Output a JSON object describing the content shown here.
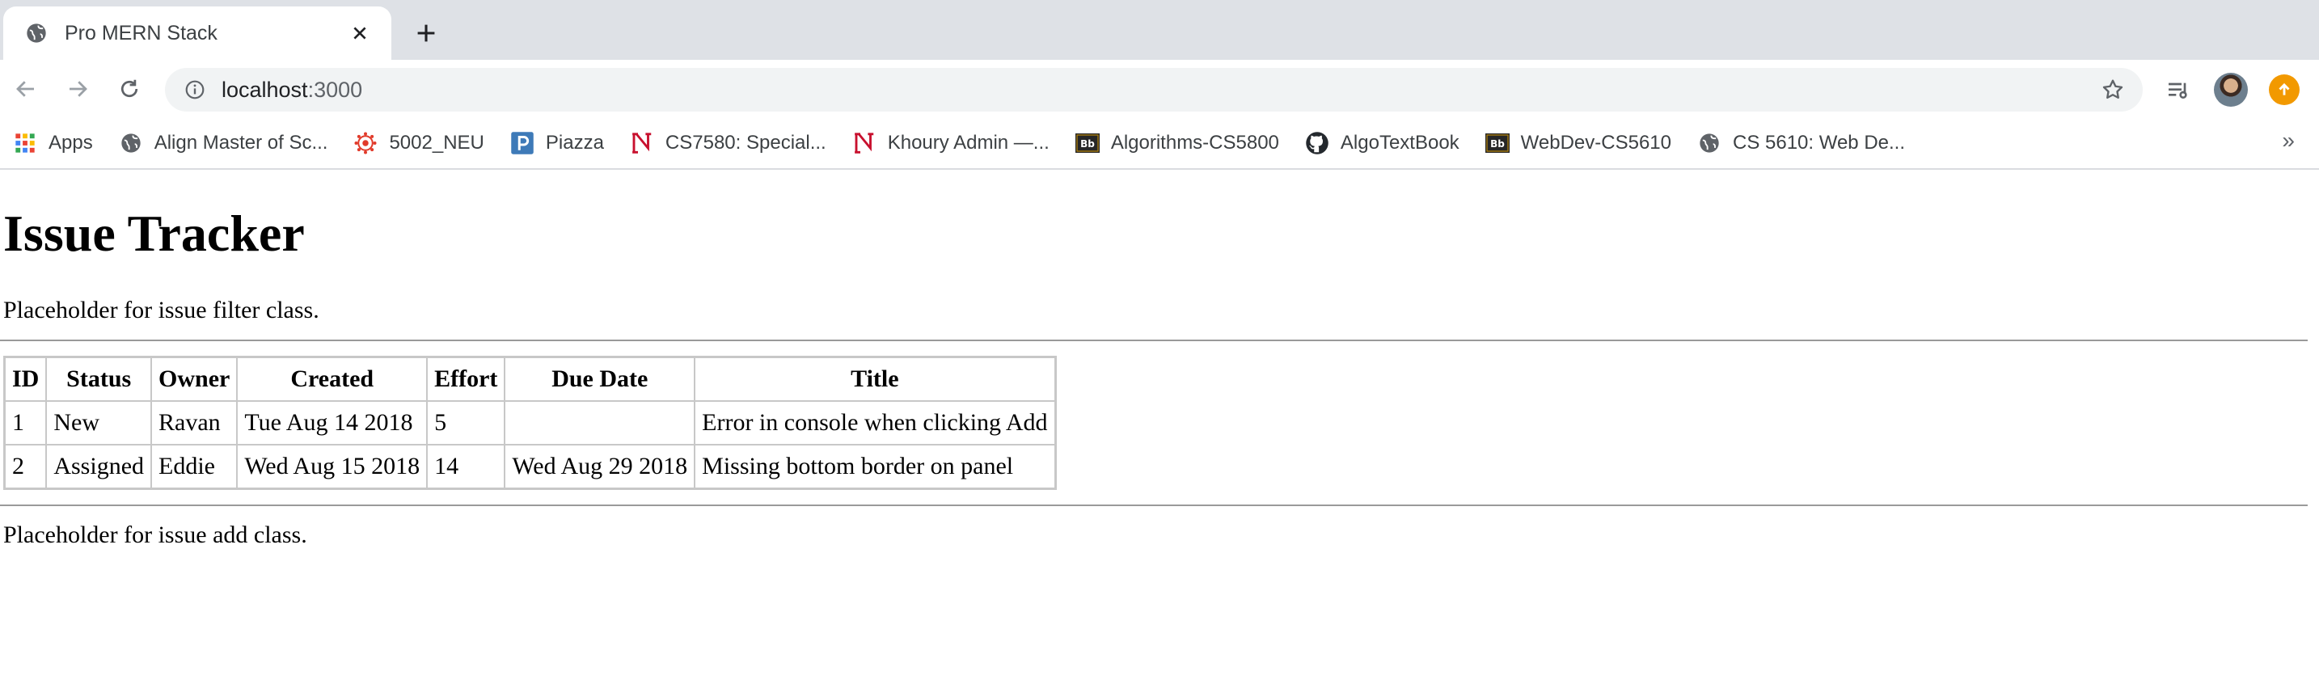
{
  "browser": {
    "tab": {
      "title": "Pro MERN Stack"
    },
    "address": {
      "host": "localhost",
      "port": ":3000"
    },
    "bookmarks": [
      {
        "label": "Apps",
        "icon": "apps-grid-icon"
      },
      {
        "label": "Align Master of Sc...",
        "icon": "globe-icon"
      },
      {
        "label": "5002_NEU",
        "icon": "canvas-icon"
      },
      {
        "label": "Piazza",
        "icon": "piazza-icon"
      },
      {
        "label": "CS7580: Special...",
        "icon": "northeastern-icon"
      },
      {
        "label": "Khoury Admin —...",
        "icon": "northeastern-icon"
      },
      {
        "label": "Algorithms-CS5800",
        "icon": "blackboard-icon"
      },
      {
        "label": "AlgoTextBook",
        "icon": "github-icon"
      },
      {
        "label": "WebDev-CS5610",
        "icon": "blackboard-icon"
      },
      {
        "label": "CS 5610: Web De...",
        "icon": "globe-icon"
      }
    ],
    "bookmarks_more": "»"
  },
  "page": {
    "heading": "Issue Tracker",
    "filter_placeholder": "Placeholder for issue filter class.",
    "add_placeholder": "Placeholder for issue add class.",
    "table": {
      "headers": [
        "ID",
        "Status",
        "Owner",
        "Created",
        "Effort",
        "Due Date",
        "Title"
      ],
      "rows": [
        [
          "1",
          "New",
          "Ravan",
          "Tue Aug 14 2018",
          "5",
          "",
          "Error in console when clicking Add"
        ],
        [
          "2",
          "Assigned",
          "Eddie",
          "Wed Aug 15 2018",
          "14",
          "Wed Aug 29 2018",
          "Missing bottom border on panel"
        ]
      ]
    }
  },
  "colors": {
    "tabstrip_bg": "#dee1e6",
    "omnibox_bg": "#f1f3f4",
    "update_badge": "#f29900",
    "table_border": "#c8c8c8"
  }
}
